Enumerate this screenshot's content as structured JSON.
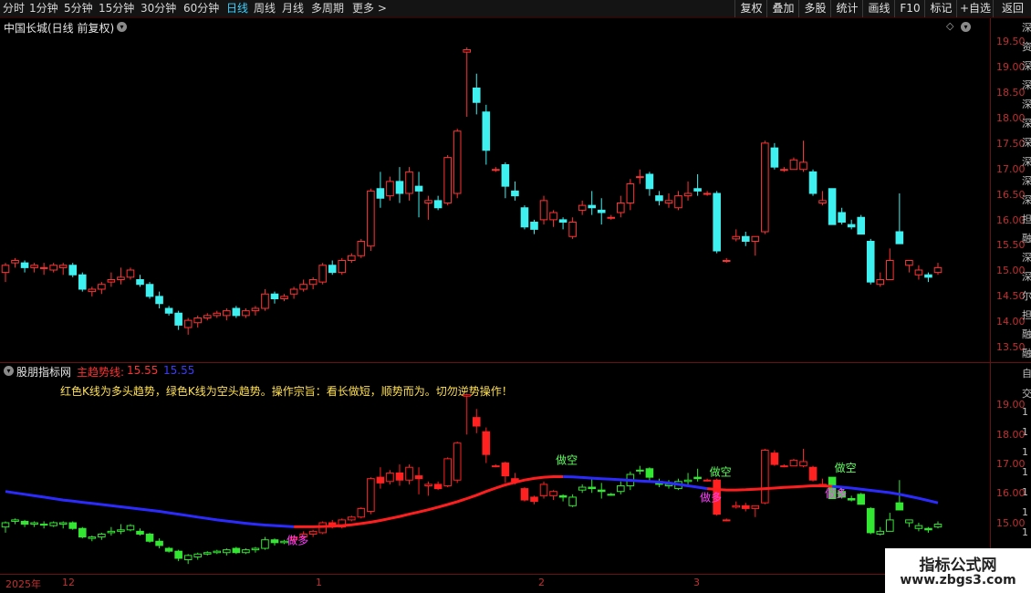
{
  "toolbar": {
    "periods": [
      {
        "label": "分时"
      },
      {
        "label": "1分钟"
      },
      {
        "label": "5分钟"
      },
      {
        "label": "15分钟"
      },
      {
        "label": "30分钟"
      },
      {
        "label": "60分钟"
      },
      {
        "label": "日线"
      },
      {
        "label": "周线"
      },
      {
        "label": "月线"
      },
      {
        "label": "多周期"
      },
      {
        "label": "更多 >"
      }
    ],
    "active_period": "日线",
    "right_buttons": [
      {
        "label": "复权"
      },
      {
        "label": "叠加"
      },
      {
        "label": "多股"
      },
      {
        "label": "统计"
      },
      {
        "label": "画线"
      },
      {
        "label": "F10"
      },
      {
        "label": "标记"
      },
      {
        "label": "+自选"
      },
      {
        "label": "返回"
      }
    ]
  },
  "main_panel": {
    "title": "中国长城(日线 前复权)",
    "y_ticks": [
      "19.50",
      "19.00",
      "18.50",
      "18.00",
      "17.50",
      "17.00",
      "16.50",
      "16.00",
      "15.50",
      "15.00",
      "14.50",
      "14.00",
      "13.50"
    ],
    "right_edge_chars": [
      "深",
      "资",
      "深",
      "深",
      "深",
      "深",
      "深",
      "深",
      "深",
      "深",
      "担",
      "融",
      "深",
      "深",
      "尔",
      "担",
      "融",
      "融"
    ]
  },
  "indicator_panel": {
    "name": "股朋指标网",
    "line_label": "主趋势线:",
    "line_value_red": "15.55",
    "line_value_blue": "15.55",
    "description": "红色K线为多头趋势，绿色K线为空头趋势。操作宗旨：看长做短，顺势而为。切勿逆势操作！",
    "y_ticks": [
      "19.00",
      "18.00",
      "17.00",
      "16.00",
      "15.00"
    ],
    "signals": [
      {
        "label": "做多",
        "color": "#ff40ff"
      },
      {
        "label": "做空",
        "color": "#60ff60"
      },
      {
        "label": "做多",
        "color": "#ff40ff"
      },
      {
        "label": "做空",
        "color": "#60ff60"
      },
      {
        "label": "做多",
        "color": "#ff40ff"
      },
      {
        "label": "做空",
        "color": "#60ff60"
      }
    ],
    "right_edge_chars": [
      "自",
      "交",
      "1",
      "1",
      "1",
      "1",
      "1",
      "1",
      "1",
      "1"
    ]
  },
  "x_axis": {
    "labels": [
      "2025年",
      "12",
      "1",
      "2",
      "3"
    ]
  },
  "watermark": {
    "line1": "指标公式网",
    "line2": "www.zbgs3.com"
  },
  "colors": {
    "up": "#ff3232",
    "down": "#3ef0f0",
    "ind_up": "#ff2020",
    "ind_down": "#32e632",
    "trend_red": "#ff1e1e",
    "trend_blue": "#2b2bff",
    "active": "#3ad0ff",
    "axis": "#c03030"
  },
  "chart_data": {
    "type": "candlestick",
    "title": "中国长城(日线 前复权)",
    "ylim": [
      13.3,
      19.7
    ],
    "ohlc": [
      [
        14.85,
        15.05,
        14.65,
        15.0
      ],
      [
        15.05,
        15.15,
        14.95,
        15.1
      ],
      [
        15.05,
        15.1,
        14.85,
        14.95
      ],
      [
        14.95,
        15.05,
        14.85,
        15.0
      ],
      [
        14.95,
        15.05,
        14.8,
        14.95
      ],
      [
        14.9,
        15.05,
        14.85,
        15.0
      ],
      [
        14.95,
        15.05,
        14.8,
        15.0
      ],
      [
        15.0,
        15.05,
        14.75,
        14.8
      ],
      [
        14.8,
        14.85,
        14.45,
        14.5
      ],
      [
        14.45,
        14.55,
        14.35,
        14.5
      ],
      [
        14.5,
        14.65,
        14.4,
        14.6
      ],
      [
        14.65,
        14.85,
        14.55,
        14.7
      ],
      [
        14.7,
        14.95,
        14.6,
        14.75
      ],
      [
        14.75,
        14.95,
        14.7,
        14.9
      ],
      [
        14.7,
        14.8,
        14.55,
        14.6
      ],
      [
        14.6,
        14.65,
        14.3,
        14.35
      ],
      [
        14.35,
        14.45,
        14.1,
        14.2
      ],
      [
        14.1,
        14.15,
        13.95,
        14.0
      ],
      [
        14.0,
        14.05,
        13.65,
        13.75
      ],
      [
        13.7,
        13.9,
        13.55,
        13.85
      ],
      [
        13.8,
        13.95,
        13.7,
        13.9
      ],
      [
        13.9,
        14.0,
        13.85,
        13.95
      ],
      [
        13.95,
        14.05,
        13.9,
        14.0
      ],
      [
        13.95,
        14.1,
        13.85,
        14.05
      ],
      [
        14.1,
        14.15,
        13.9,
        13.95
      ],
      [
        13.95,
        14.1,
        13.9,
        14.05
      ],
      [
        14.05,
        14.15,
        13.95,
        14.1
      ],
      [
        14.1,
        14.5,
        14.05,
        14.4
      ],
      [
        14.4,
        14.45,
        14.2,
        14.3
      ],
      [
        14.3,
        14.4,
        14.25,
        14.35
      ],
      [
        14.4,
        14.55,
        14.3,
        14.5
      ],
      [
        14.5,
        14.7,
        14.45,
        14.6
      ],
      [
        14.6,
        14.75,
        14.5,
        14.7
      ],
      [
        14.65,
        15.05,
        14.6,
        15.0
      ],
      [
        15.0,
        15.1,
        14.8,
        14.85
      ],
      [
        14.85,
        15.15,
        14.8,
        15.1
      ],
      [
        15.1,
        15.25,
        15.05,
        15.2
      ],
      [
        15.2,
        15.55,
        15.15,
        15.5
      ],
      [
        15.4,
        16.6,
        15.3,
        16.55
      ],
      [
        16.6,
        16.95,
        16.2,
        16.4
      ],
      [
        16.45,
        16.85,
        16.35,
        16.75
      ],
      [
        16.75,
        17.05,
        16.3,
        16.5
      ],
      [
        16.5,
        17.05,
        16.35,
        16.95
      ],
      [
        16.65,
        16.95,
        16.0,
        16.55
      ],
      [
        16.3,
        16.45,
        15.95,
        16.35
      ],
      [
        16.35,
        16.45,
        16.15,
        16.2
      ],
      [
        16.3,
        17.3,
        16.25,
        17.25
      ],
      [
        16.5,
        17.85,
        16.4,
        17.8
      ],
      [
        19.45,
        19.55,
        18.1,
        19.5
      ],
      [
        18.7,
        19.0,
        18.15,
        18.4
      ],
      [
        18.2,
        18.35,
        17.1,
        17.4
      ],
      [
        17.0,
        17.05,
        16.95,
        17.0
      ],
      [
        17.1,
        17.15,
        16.4,
        16.65
      ],
      [
        16.55,
        16.75,
        16.35,
        16.45
      ],
      [
        16.2,
        16.25,
        15.75,
        15.8
      ],
      [
        15.9,
        15.95,
        15.65,
        15.75
      ],
      [
        15.95,
        16.45,
        15.85,
        16.35
      ],
      [
        15.95,
        16.15,
        15.8,
        16.1
      ],
      [
        15.95,
        16.0,
        15.75,
        15.9
      ],
      [
        15.6,
        16.0,
        15.55,
        15.9
      ],
      [
        16.15,
        16.35,
        16.05,
        16.25
      ],
      [
        16.25,
        16.55,
        16.05,
        16.2
      ],
      [
        16.15,
        16.4,
        15.85,
        16.1
      ],
      [
        16.0,
        16.05,
        15.95,
        16.0
      ],
      [
        16.1,
        16.45,
        16.0,
        16.3
      ],
      [
        16.3,
        16.8,
        16.15,
        16.7
      ],
      [
        16.85,
        17.0,
        16.7,
        16.85
      ],
      [
        16.9,
        16.95,
        16.45,
        16.6
      ],
      [
        16.45,
        16.55,
        16.25,
        16.35
      ],
      [
        16.3,
        16.5,
        16.2,
        16.35
      ],
      [
        16.2,
        16.55,
        16.15,
        16.45
      ],
      [
        16.45,
        16.75,
        16.35,
        16.5
      ],
      [
        16.6,
        16.9,
        16.45,
        16.55
      ],
      [
        16.5,
        16.55,
        16.45,
        16.5
      ],
      [
        16.5,
        16.55,
        15.25,
        15.3
      ],
      [
        15.1,
        15.15,
        15.05,
        15.1
      ],
      [
        15.55,
        15.75,
        15.5,
        15.6
      ],
      [
        15.6,
        15.7,
        15.4,
        15.5
      ],
      [
        15.5,
        15.6,
        15.2,
        15.6
      ],
      [
        15.7,
        17.6,
        15.65,
        17.55
      ],
      [
        17.45,
        17.55,
        17.0,
        17.05
      ],
      [
        17.0,
        17.05,
        16.95,
        17.0
      ],
      [
        17.0,
        17.25,
        17.0,
        17.2
      ],
      [
        17.0,
        17.6,
        16.95,
        17.15
      ],
      [
        16.95,
        17.0,
        16.45,
        16.5
      ],
      [
        16.3,
        16.55,
        16.25,
        16.35
      ],
      [
        16.6,
        16.6,
        15.85,
        15.85
      ],
      [
        16.1,
        16.2,
        15.85,
        15.9
      ],
      [
        15.85,
        15.95,
        15.75,
        15.8
      ],
      [
        16.0,
        16.05,
        15.7,
        15.65
      ],
      [
        15.5,
        15.55,
        14.6,
        14.65
      ],
      [
        14.6,
        14.85,
        14.55,
        14.7
      ],
      [
        14.7,
        15.35,
        14.7,
        15.1
      ],
      [
        15.7,
        16.5,
        15.55,
        15.45
      ],
      [
        15.0,
        15.1,
        14.85,
        15.1
      ],
      [
        14.8,
        15.0,
        14.7,
        14.9
      ],
      [
        14.8,
        14.85,
        14.65,
        14.75
      ],
      [
        14.85,
        15.05,
        14.8,
        14.95
      ]
    ],
    "indicator_ylim": [
      13.3,
      20.1
    ],
    "trend_line": [
      16.1,
      16.05,
      16.0,
      15.95,
      15.9,
      15.85,
      15.8,
      15.76,
      15.72,
      15.68,
      15.64,
      15.6,
      15.56,
      15.52,
      15.48,
      15.44,
      15.4,
      15.35,
      15.3,
      15.25,
      15.2,
      15.15,
      15.1,
      15.06,
      15.02,
      14.98,
      14.95,
      14.92,
      14.9,
      14.88,
      14.86,
      14.86,
      14.86,
      14.87,
      14.88,
      14.9,
      14.93,
      14.97,
      15.02,
      15.08,
      15.15,
      15.22,
      15.3,
      15.38,
      15.46,
      15.55,
      15.64,
      15.74,
      15.85,
      15.97,
      16.1,
      16.22,
      16.33,
      16.42,
      16.5,
      16.56,
      16.6,
      16.62,
      16.62,
      16.61,
      16.59,
      16.57,
      16.55,
      16.53,
      16.51,
      16.49,
      16.47,
      16.45,
      16.43,
      16.4,
      16.35,
      16.3,
      16.25,
      16.2,
      16.17,
      16.15,
      16.15,
      16.16,
      16.18,
      16.2,
      16.22,
      16.24,
      16.26,
      16.28,
      16.3,
      16.3,
      16.28,
      16.25,
      16.22,
      16.18,
      16.14,
      16.1,
      16.06,
      16.0,
      15.93,
      15.86,
      15.78,
      15.7,
      15.62,
      15.55
    ],
    "trend_color_segments": [
      {
        "from": 0,
        "to": 30,
        "color": "blue"
      },
      {
        "from": 30,
        "to": 58,
        "color": "red"
      },
      {
        "from": 58,
        "to": 73,
        "color": "blue"
      },
      {
        "from": 73,
        "to": 86,
        "color": "red"
      },
      {
        "from": 86,
        "to": 99,
        "color": "blue"
      }
    ]
  }
}
